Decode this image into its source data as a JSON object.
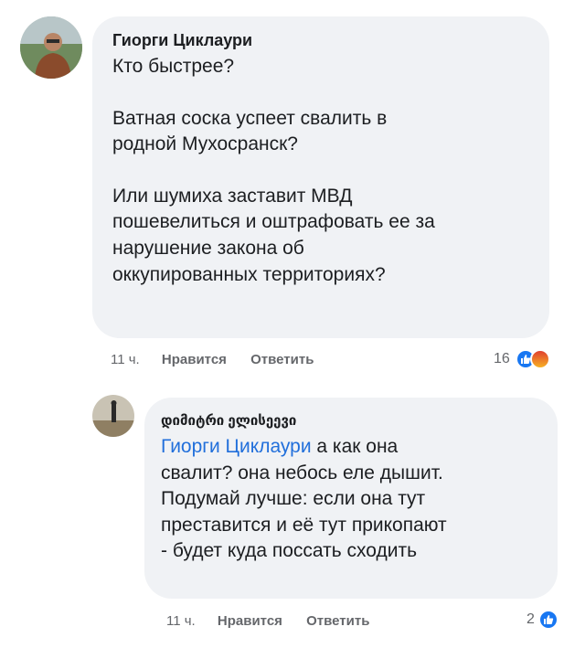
{
  "comment1": {
    "author": "Гиорги Циклаури",
    "paragraphs": [
      [
        "Кто быстрее?"
      ],
      [
        "Ватная соска успеет свалить в",
        "родной Мухосранск?"
      ],
      [
        "Или шумиха заставит МВД",
        "пошевелиться и оштрафовать ее за",
        "нарушение закона об",
        "оккупированных территориях?"
      ]
    ],
    "time": "11 ч.",
    "like_label": "Нравится",
    "reply_label": "Ответить",
    "reaction_count": "16",
    "reactions": [
      "like-icon",
      "angry-icon"
    ]
  },
  "comment2": {
    "author": "დიმიტრი ელისეევი",
    "mention": "Гиорги Циклаури",
    "line1_rest": " а как она",
    "lines": [
      "свалит? она небось еле дышит.",
      "Подумай лучше: если она тут",
      "преставится и её тут прикопают",
      "- будет куда поссать сходить"
    ],
    "time": "11 ч.",
    "like_label": "Нравится",
    "reply_label": "Ответить",
    "reaction_count": "2",
    "reactions": [
      "like-icon"
    ]
  },
  "colors": {
    "bubble": "#f0f2f5",
    "link": "#216fdb",
    "meta": "#65676b",
    "like": "#1877f2"
  }
}
